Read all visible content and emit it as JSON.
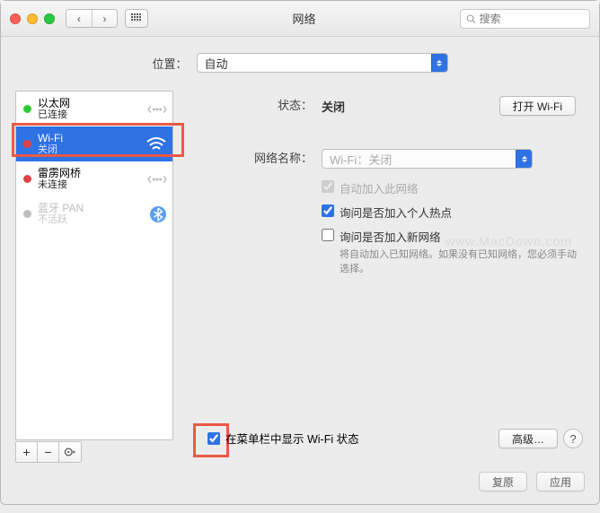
{
  "titlebar": {
    "title": "网络",
    "search_placeholder": "搜索"
  },
  "location": {
    "label": "位置：",
    "selected": "自动"
  },
  "services": [
    {
      "name": "以太网",
      "state": "已连接",
      "status": "green",
      "icon": "arrows"
    },
    {
      "name": "Wi-Fi",
      "state": "关闭",
      "status": "red",
      "icon": "wifi",
      "selected": true
    },
    {
      "name": "雷雳网桥",
      "state": "未连接",
      "status": "red",
      "icon": "arrows"
    },
    {
      "name": "蓝牙 PAN",
      "state": "不活跃",
      "status": "gray",
      "icon": "bluetooth",
      "dim": true
    }
  ],
  "detail": {
    "status_label": "状态：",
    "status_value": "关闭",
    "wifi_toggle": "打开 Wi-Fi",
    "network_name_label": "网络名称：",
    "network_name_value": "Wi-Fi：关闭",
    "auto_join": "自动加入此网络",
    "ask_hotspot": "询问是否加入个人热点",
    "ask_new": "询问是否加入新网络",
    "ask_new_hint": "将自动加入已知网络。如果没有已知网络，您必须手动选择。"
  },
  "showbar": "在菜单栏中显示 Wi-Fi 状态",
  "buttons": {
    "advanced": "高级…",
    "revert": "复原",
    "apply": "应用"
  },
  "watermark": "www.MacDown.com"
}
